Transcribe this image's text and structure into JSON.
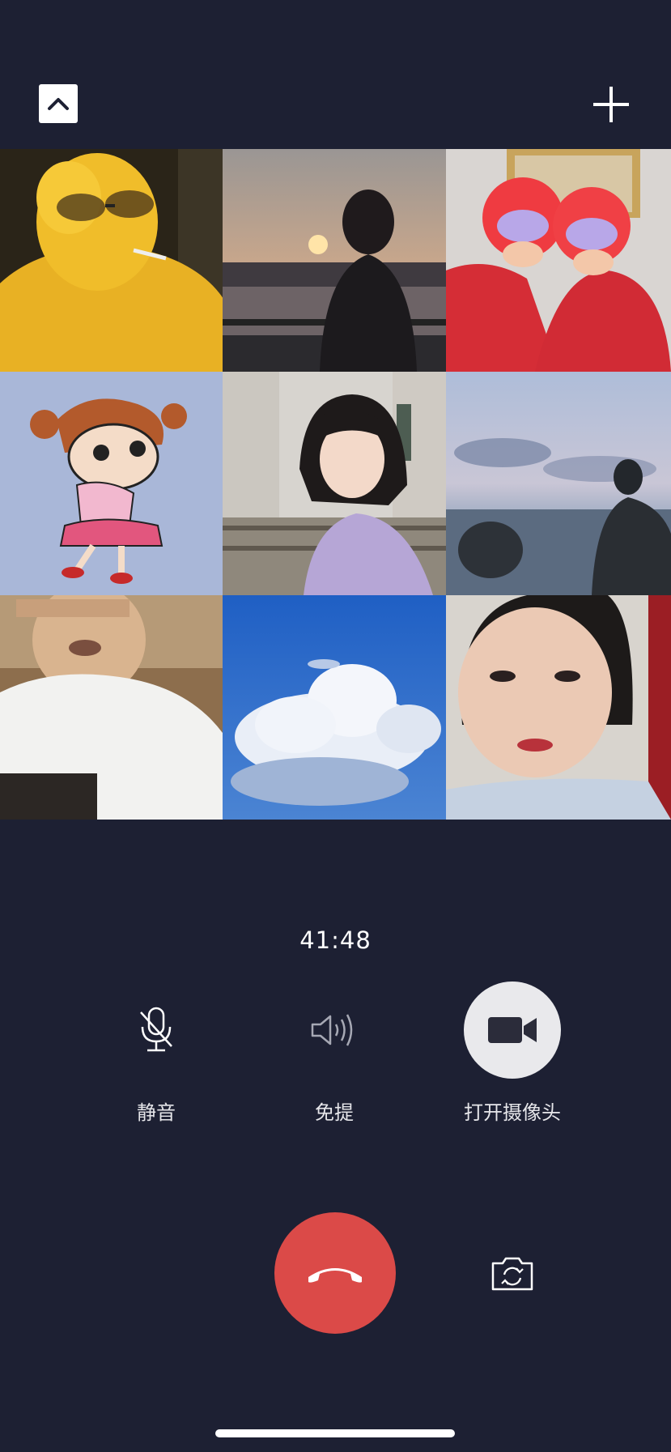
{
  "call": {
    "timer": "41:48"
  },
  "top_bar": {
    "collapse_icon": "chevron-up-icon",
    "add_icon": "plus-icon"
  },
  "participants": [
    {
      "icon": "yellow-hood-avatar"
    },
    {
      "icon": "sunset-girl-avatar"
    },
    {
      "icon": "two-kids-helmets-avatar"
    },
    {
      "icon": "cartoon-girl-avatar"
    },
    {
      "icon": "short-hair-girl-avatar"
    },
    {
      "icon": "sea-man-avatar"
    },
    {
      "icon": "white-shirt-man-video"
    },
    {
      "icon": "blue-sky-clouds-avatar"
    },
    {
      "icon": "woman-selfie-video"
    }
  ],
  "controls": {
    "mute_label": "静音",
    "speaker_label": "免提",
    "camera_label": "打开摄像头"
  },
  "colors": {
    "background": "#1d2033",
    "hangup": "#db4a48",
    "camera_button_bg": "#e9e9ec"
  }
}
